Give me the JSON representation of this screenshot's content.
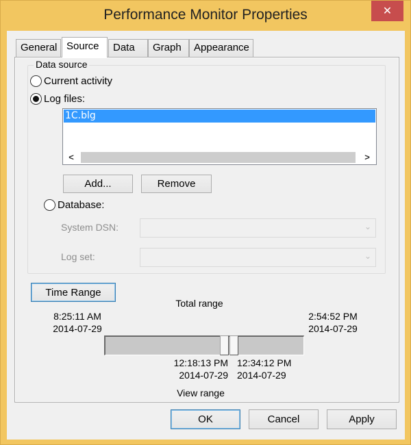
{
  "window": {
    "title": "Performance Monitor Properties",
    "close_icon": "✕"
  },
  "tabs": [
    {
      "label": "General",
      "active": false
    },
    {
      "label": "Source",
      "active": true
    },
    {
      "label": "Data",
      "active": false
    },
    {
      "label": "Graph",
      "active": false
    },
    {
      "label": "Appearance",
      "active": false
    }
  ],
  "data_source": {
    "group_title": "Data source",
    "current_activity_label": "Current activity",
    "current_activity_selected": false,
    "log_files_label": "Log files:",
    "log_files_selected": true,
    "log_files": [
      {
        "name": "1C.blg",
        "selected": true
      }
    ],
    "scroll_left_icon": "<",
    "scroll_right_icon": ">",
    "add_button": "Add...",
    "remove_button": "Remove",
    "database_label": "Database:",
    "database_selected": false,
    "system_dsn_label": "System DSN:",
    "system_dsn_value": "",
    "log_set_label": "Log set:",
    "log_set_value": "",
    "dropdown_icon": "⌄"
  },
  "time_range": {
    "button_label": "Time Range",
    "total_range_label": "Total range",
    "total_start_time": "8:25:11 AM",
    "total_start_date": "2014-07-29",
    "total_end_time": "2:54:52 PM",
    "total_end_date": "2014-07-29",
    "view_start_time": "12:18:13 PM",
    "view_start_date": "2014-07-29",
    "view_end_time": "12:34:12 PM",
    "view_end_date": "2014-07-29",
    "view_range_label": "View range",
    "view_start_fraction": 0.6,
    "view_end_fraction": 0.641
  },
  "footer": {
    "ok_button": "OK",
    "cancel_button": "Cancel",
    "apply_button": "Apply"
  }
}
